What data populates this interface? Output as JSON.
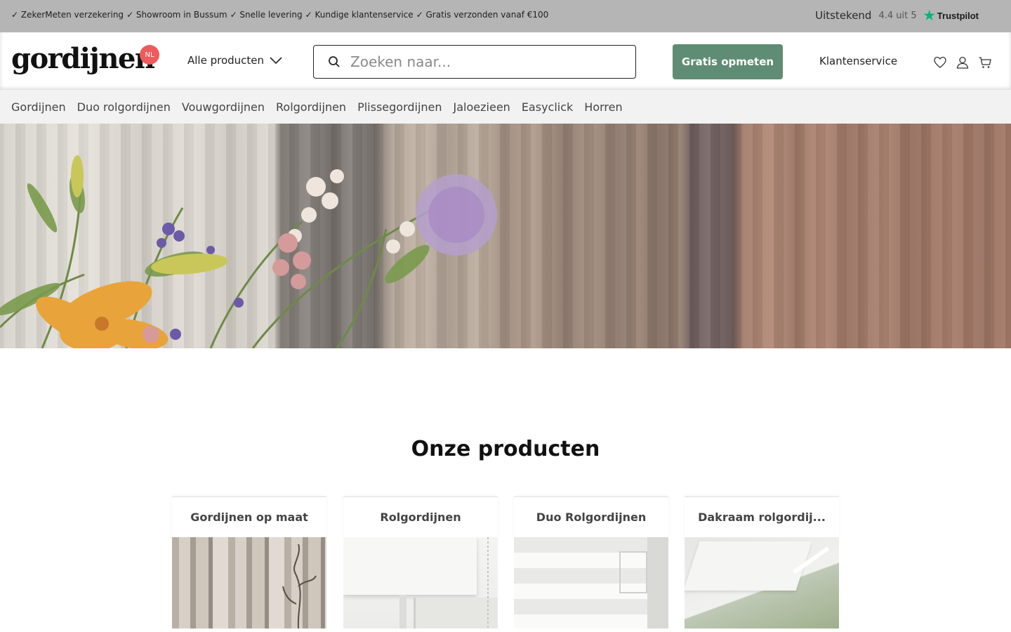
{
  "topbar": {
    "usps": [
      "✓ ZekerMeten verzekering",
      "✓ Showroom in Bussum",
      "✓ Snelle levering",
      "✓ Kundige klantenservice",
      "✓ Gratis verzonden vanaf €100"
    ],
    "trustpilot_label": "Uitstekend",
    "trustpilot_score": "4.4 uit 5",
    "trustpilot_brand": "Trustpilot"
  },
  "header": {
    "logo": "gordijnen",
    "locale_badge": "NL",
    "all_products": "Alle producten",
    "search_placeholder": "Zoeken naar...",
    "measure_button": "Gratis opmeten",
    "customer_service": "Klantenservice"
  },
  "catnav": [
    "Gordijnen",
    "Duo rolgordijnen",
    "Vouwgordijnen",
    "Rolgordijnen",
    "Plissegordijnen",
    "Jaloezieen",
    "Easyclick",
    "Horren"
  ],
  "products": {
    "title": "Onze producten",
    "cards": [
      {
        "title": "Gordijnen op maat"
      },
      {
        "title": "Rolgordijnen"
      },
      {
        "title": "Duo Rolgordijnen"
      },
      {
        "title": "Dakraam rolgordij..."
      }
    ]
  },
  "colors": {
    "topbar": "#b5b5b5",
    "accent_green": "#5f8c74",
    "badge_red": "#ee5b5b",
    "trustpilot_green": "#00b67a"
  }
}
